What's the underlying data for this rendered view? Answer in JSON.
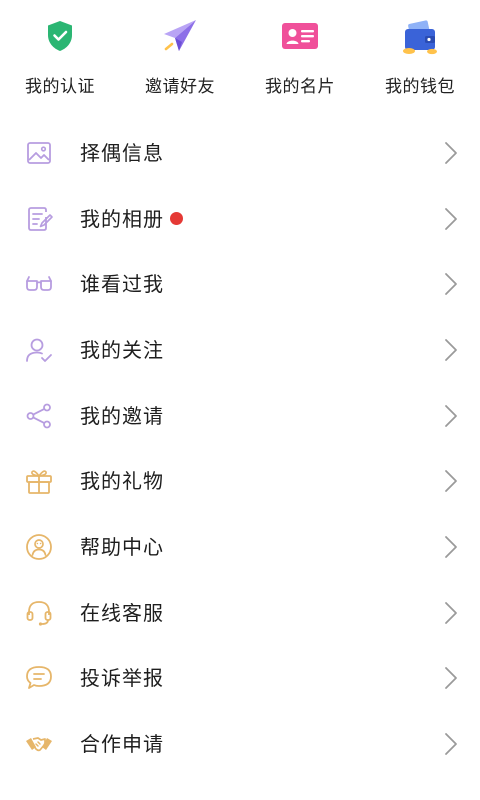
{
  "quick_actions": [
    {
      "label": "我的认证",
      "icon": "shield-check-icon",
      "color": "#2bb673"
    },
    {
      "label": "邀请好友",
      "icon": "paper-plane-icon",
      "color": "#9b7ef0"
    },
    {
      "label": "我的名片",
      "icon": "id-card-icon",
      "color": "#f0509a"
    },
    {
      "label": "我的钱包",
      "icon": "wallet-icon",
      "color": "#3a63d8"
    }
  ],
  "menu": [
    {
      "label": "择偶信息",
      "icon": "image-icon",
      "color": "#b79de0",
      "badge": false
    },
    {
      "label": "我的相册",
      "icon": "edit-note-icon",
      "color": "#b79de0",
      "badge": true,
      "badge_color": "#e53935"
    },
    {
      "label": "谁看过我",
      "icon": "glasses-icon",
      "color": "#b79de0",
      "badge": false
    },
    {
      "label": "我的关注",
      "icon": "user-follow-icon",
      "color": "#b79de0",
      "badge": false
    },
    {
      "label": "我的邀请",
      "icon": "share-icon",
      "color": "#b79de0",
      "badge": false
    },
    {
      "label": "我的礼物",
      "icon": "gift-icon",
      "color": "#e6b66a",
      "badge": false
    },
    {
      "label": "帮助中心",
      "icon": "help-person-icon",
      "color": "#e6b66a",
      "badge": false
    },
    {
      "label": "在线客服",
      "icon": "headset-icon",
      "color": "#e6b66a",
      "badge": false
    },
    {
      "label": "投诉举报",
      "icon": "chat-bubble-icon",
      "color": "#e6b66a",
      "badge": false
    },
    {
      "label": "合作申请",
      "icon": "handshake-icon",
      "color": "#e6b66a",
      "badge": false
    }
  ],
  "colors": {
    "chevron": "#9a9a9a",
    "text": "#1e1e1e"
  }
}
